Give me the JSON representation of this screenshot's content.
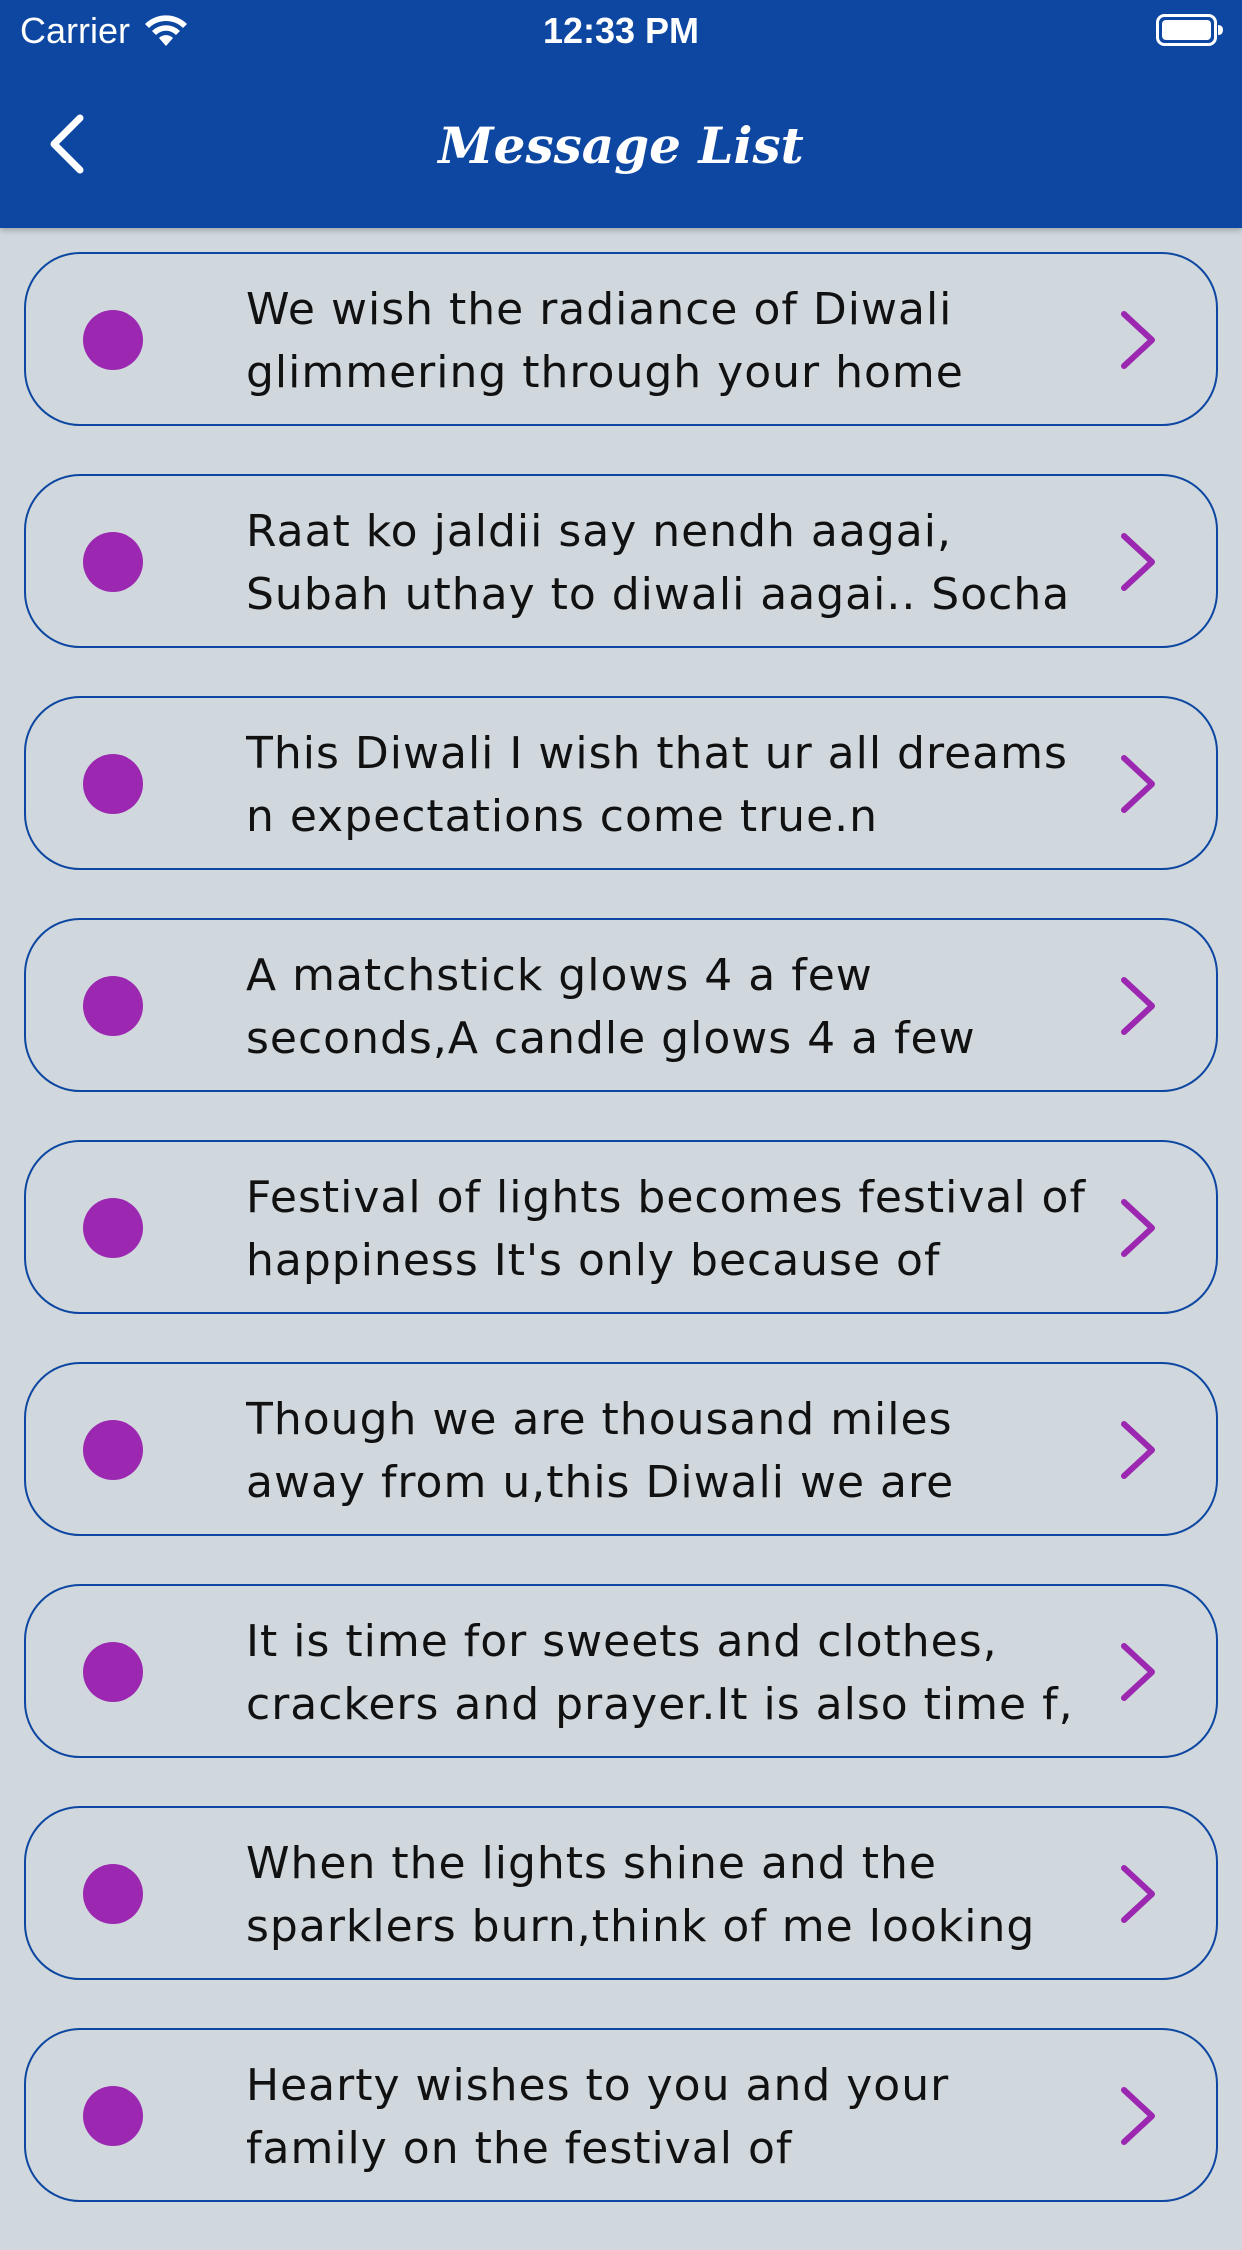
{
  "status_bar": {
    "carrier": "Carrier",
    "time": "12:33 PM"
  },
  "header": {
    "title": "Message List",
    "back_icon": "chevron-left-icon",
    "color": "#0d47a1"
  },
  "colors": {
    "background": "#d0d8de",
    "accent": "#9c27b0",
    "border": "#0d47a1"
  },
  "messages": [
    {
      "text": "We wish the radiance of Diwali glimmering through your home"
    },
    {
      "text": "Raat ko jaldii say nendh aagai, Subah uthay to diwali aagai.. Socha"
    },
    {
      "text": "This Diwali I wish that ur all dreams n expectations come true.n"
    },
    {
      "text": "A matchstick glows 4 a few seconds,A candle glows 4 a few"
    },
    {
      "text": "Festival of lights becomes festival of happiness It's only because of"
    },
    {
      "text": "Though we are thousand miles away from u,this Diwali we are"
    },
    {
      "text": "It is time for sweets and clothes, crackers and prayer.It is also time f,"
    },
    {
      "text": "When the lights shine and the sparklers burn,think of me looking"
    },
    {
      "text": "Hearty wishes to you and your family on the festival of"
    }
  ]
}
